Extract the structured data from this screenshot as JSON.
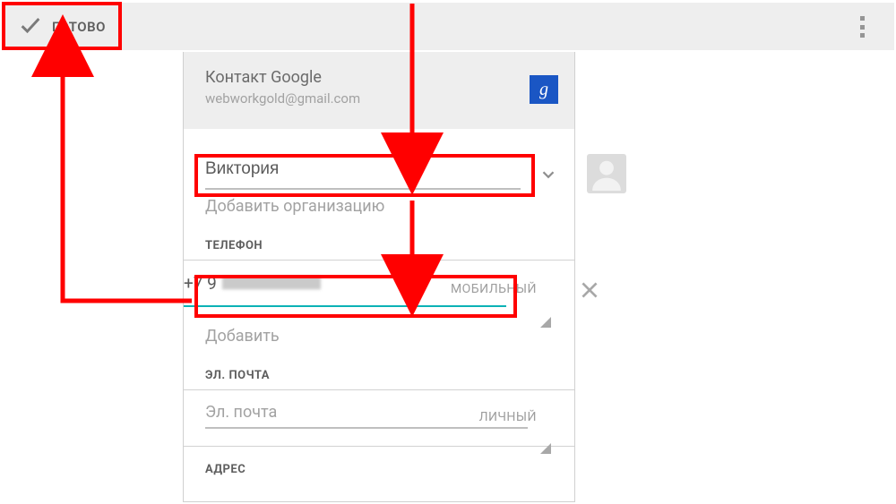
{
  "topbar": {
    "done_label": "ГОТОВО"
  },
  "account": {
    "title": "Контакт Google",
    "email": "webworkgold@gmail.com",
    "icon_glyph": "g"
  },
  "name": {
    "value": "Виктория"
  },
  "org": {
    "placeholder": "Добавить организацию"
  },
  "sections": {
    "phone": "ТЕЛЕФОН",
    "email": "ЭЛ. ПОЧТА",
    "address": "АДРЕС"
  },
  "phone": {
    "value_prefix": "+7 9",
    "type": "МОБИЛЬНЫЙ",
    "add_more": "Добавить"
  },
  "email": {
    "placeholder": "Эл. почта",
    "type": "ЛИЧНЫЙ"
  }
}
